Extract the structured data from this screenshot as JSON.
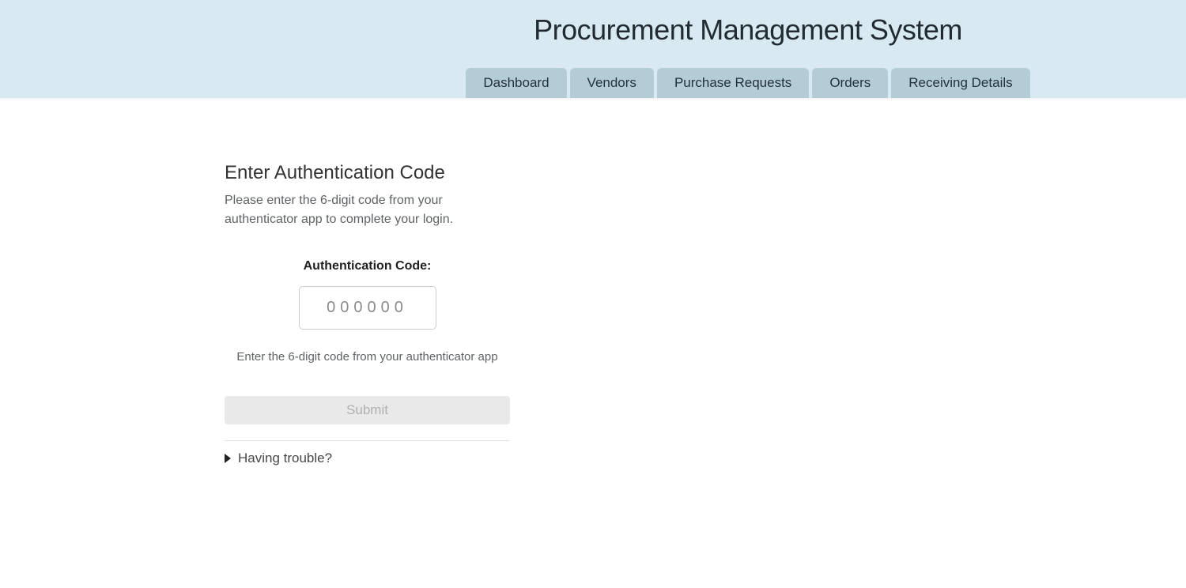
{
  "header": {
    "title": "Procurement Management System",
    "nav": [
      {
        "label": "Dashboard"
      },
      {
        "label": "Vendors"
      },
      {
        "label": "Purchase Requests"
      },
      {
        "label": "Orders"
      },
      {
        "label": "Receiving Details"
      }
    ]
  },
  "auth": {
    "heading": "Enter Authentication Code",
    "description": "Please enter the 6-digit code from your authenticator app to complete your login.",
    "code_label": "Authentication Code:",
    "code_placeholder": "000000",
    "code_value": "",
    "helper_text": "Enter the 6-digit code from your authenticator app",
    "submit_label": "Submit",
    "trouble_label": "Having trouble?"
  },
  "theme": {
    "header_bg": "#d8e9f2",
    "tab_bg": "#b3ccd6",
    "tab_text": "#233239",
    "title_text": "#212b31",
    "heading_text": "#333333",
    "muted_text": "#5f6265",
    "placeholder_text": "#8a8a8a",
    "submit_bg": "#e9e9e9",
    "submit_text": "#b0b0b0",
    "input_border": "#cccccc",
    "divider": "#e3e3e3"
  }
}
